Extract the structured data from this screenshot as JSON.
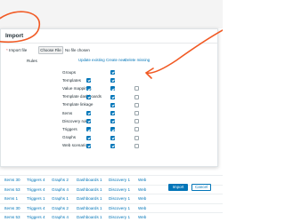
{
  "dialog": {
    "title": "Import",
    "import_file_label": "Import file",
    "file_button": "Choose File",
    "file_status": "No file chosen",
    "rules_label": "Rules",
    "columns": [
      "Update existing",
      "Create new",
      "Delete missing"
    ],
    "rows": [
      {
        "label": "Groups",
        "update": null,
        "create": true,
        "delete": null
      },
      {
        "label": "Templates",
        "update": true,
        "create": true,
        "delete": null
      },
      {
        "label": "Value mappings",
        "update": true,
        "create": true,
        "delete": false
      },
      {
        "label": "Template dashboards",
        "update": true,
        "create": true,
        "delete": false
      },
      {
        "label": "Template linkage",
        "update": null,
        "create": true,
        "delete": false
      },
      {
        "label": "Items",
        "update": true,
        "create": true,
        "delete": false
      },
      {
        "label": "Discovery rules",
        "update": true,
        "create": true,
        "delete": false
      },
      {
        "label": "Triggers",
        "update": true,
        "create": true,
        "delete": false
      },
      {
        "label": "Graphs",
        "update": true,
        "create": true,
        "delete": false
      },
      {
        "label": "Web scenarios",
        "update": true,
        "create": true,
        "delete": false
      }
    ],
    "import_button": "Import",
    "cancel_button": "Cancel"
  },
  "background": {
    "rows": [
      [
        "Items 30",
        "Triggers 4",
        "Graphs 2",
        "Dashboards 1",
        "Discovery 1",
        "Web"
      ],
      [
        "Items 53",
        "Triggers 4",
        "Graphs 4",
        "Dashboards 1",
        "Discovery 1",
        "Web"
      ],
      [
        "Items 1",
        "Triggers 1",
        "Graphs 1",
        "Dashboards 1",
        "Discovery 1",
        "Web"
      ],
      [
        "Items 30",
        "Triggers 4",
        "Graphs 2",
        "Dashboards 1",
        "Discovery 1",
        "Web"
      ],
      [
        "Items 53",
        "Triggers 4",
        "Graphs 4",
        "Dashboards 1",
        "Discovery 1",
        "Web"
      ]
    ]
  },
  "colors": {
    "accent": "#0275b8",
    "annotation": "#f15a24"
  }
}
